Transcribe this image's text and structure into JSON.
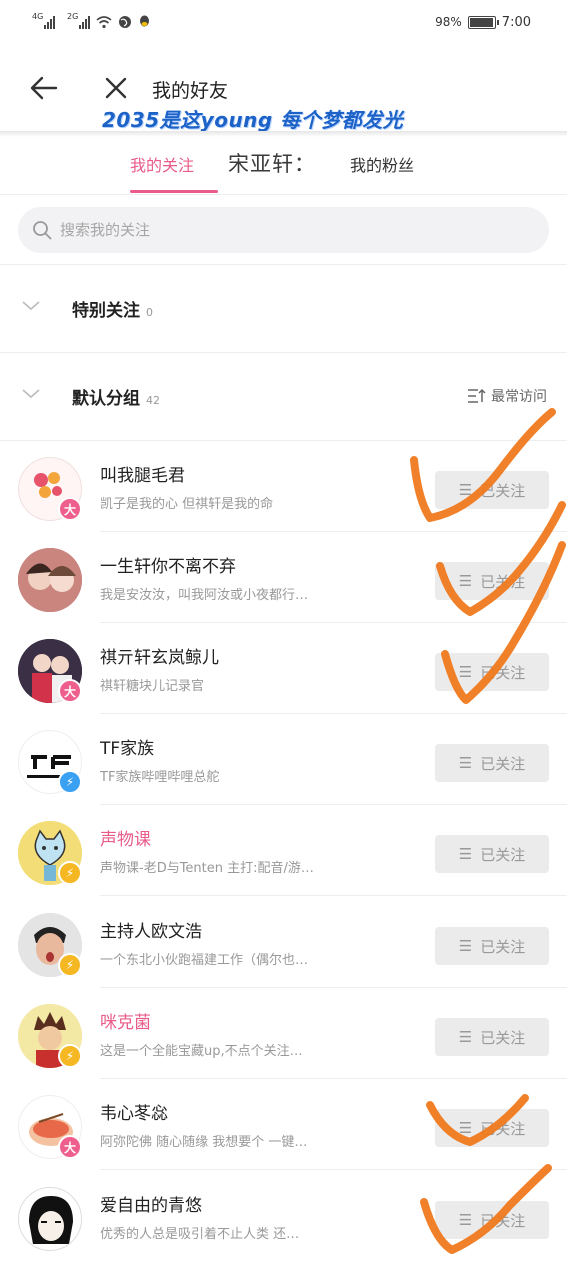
{
  "status_bar": {
    "signal_1": "4G",
    "signal_2": "2G",
    "battery": "98%",
    "battery_level": 0.98,
    "time": "7:00"
  },
  "header": {
    "title": "我的好友",
    "overlay_text": "2035是这young 每个梦都发光"
  },
  "tabs": {
    "following": "我的关注",
    "overlay_name": "宋亚轩：",
    "fans": "我的粉丝"
  },
  "search": {
    "placeholder": "搜索我的关注"
  },
  "groups": {
    "special": {
      "name": "特别关注",
      "count": "0"
    },
    "default": {
      "name": "默认分组",
      "count": "42"
    },
    "sort_label": "最常访问"
  },
  "follow_label": "已关注",
  "users": [
    {
      "name": "叫我腿毛君",
      "desc": "凯子是我的心 但祺轩是我的命",
      "badge": "大",
      "name_color": "normal"
    },
    {
      "name": "一生轩你不离不弃",
      "desc": "我是安汝汝，叫我阿汝或小夜都行…",
      "badge": "",
      "name_color": "normal"
    },
    {
      "name": "祺亓轩玄岚鲸儿",
      "desc": "祺轩糖块儿记录官",
      "badge": "大",
      "name_color": "normal"
    },
    {
      "name": "TF家族",
      "desc": "TF家族哔哩哔哩总舵",
      "badge": "⚡",
      "name_color": "normal"
    },
    {
      "name": "声物课",
      "desc": "声物课-老D与Tenten 主打:配音/游…",
      "badge": "⚡",
      "name_color": "pink"
    },
    {
      "name": "主持人欧文浩",
      "desc": "一个东北小伙跑福建工作（偶尔也…",
      "badge": "⚡",
      "name_color": "normal"
    },
    {
      "name": "咪克菌",
      "desc": "这是一个全能宝藏up,不点个关注…",
      "badge": "⚡",
      "name_color": "pink"
    },
    {
      "name": "韦心苳惢",
      "desc": "阿弥陀佛 随心随缘 我想要个 一键…",
      "badge": "大",
      "name_color": "normal"
    },
    {
      "name": "爱自由的青悠",
      "desc": "优秀的人总是吸引着不止人类 还…",
      "badge": "",
      "name_color": "normal"
    }
  ],
  "colors": {
    "accent": "#e95c8a",
    "overlay_blue": "#1d63c7",
    "scribble_orange": "#f07a1e"
  }
}
